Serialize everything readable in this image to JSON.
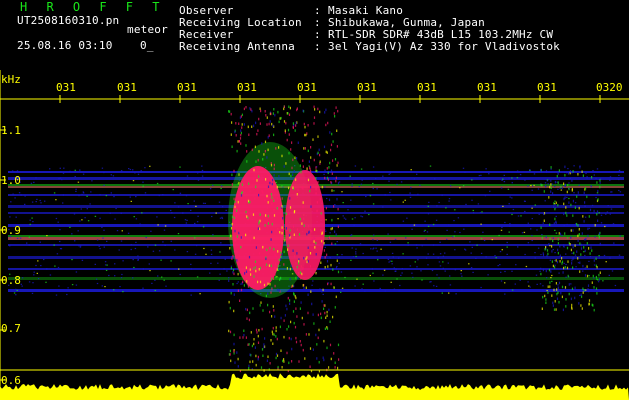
{
  "header": {
    "title": "H R O F F T",
    "file_name": "UT2508160310.pn",
    "tag": "meteor",
    "datetime": "25.08.16 03:10",
    "extra": "0_",
    "fields": [
      {
        "label": "Observer",
        "value": "Masaki Kano"
      },
      {
        "label": "Receiving Location",
        "value": "Shibukawa, Gunma, Japan"
      },
      {
        "label": "Receiver",
        "value": "RTL-SDR SDR# 43dB L15 103.2MHz CW"
      },
      {
        "label": "Receiving Antenna",
        "value": "3el Yagi(V) Az 330 for Vladivostok"
      }
    ],
    "colon": ":"
  },
  "axes": {
    "y_unit": "kHz",
    "y_ticks": [
      "1.1",
      "1.0",
      "0.9",
      "0.8",
      "0.7",
      "0.6"
    ],
    "x_ticks": [
      "031",
      "031",
      "031",
      "031",
      "031",
      "031",
      "031",
      "031",
      "031",
      "0320"
    ]
  },
  "colors": {
    "background": "#000000",
    "header_title": "#19e619",
    "text": "#ffffff",
    "axis": "#ffff00",
    "signal_hot": "#ff1a66",
    "signal_warm": "#ffff00",
    "signal_mid": "#19e619",
    "noise": "#1a1acc"
  }
}
